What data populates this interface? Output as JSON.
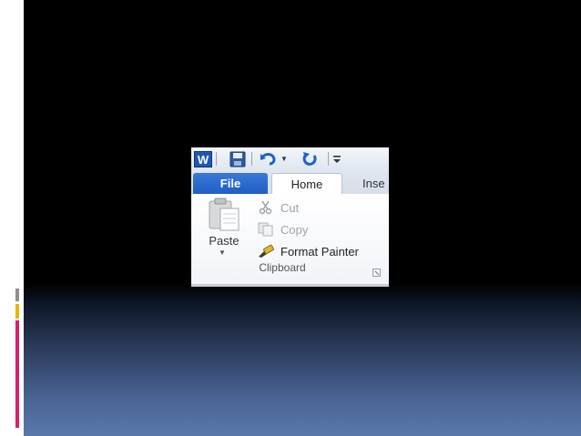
{
  "ribbon": {
    "app_icon_letter": "W",
    "tabs": {
      "file": "File",
      "home": "Home",
      "insert": "Inse"
    },
    "clipboard": {
      "paste_label": "Paste",
      "cut_label": "Cut",
      "copy_label": "Copy",
      "format_painter_label": "Format Painter",
      "group_label": "Clipboard"
    },
    "quick_access_icons": [
      "save-icon",
      "undo-icon",
      "redo-icon",
      "customize-icon"
    ]
  },
  "colors": {
    "file_tab": "#1f5ec3",
    "accent_pink": "#d91e6d",
    "accent_gold": "#e8b500",
    "slide_bottom": "#5a78aa"
  }
}
